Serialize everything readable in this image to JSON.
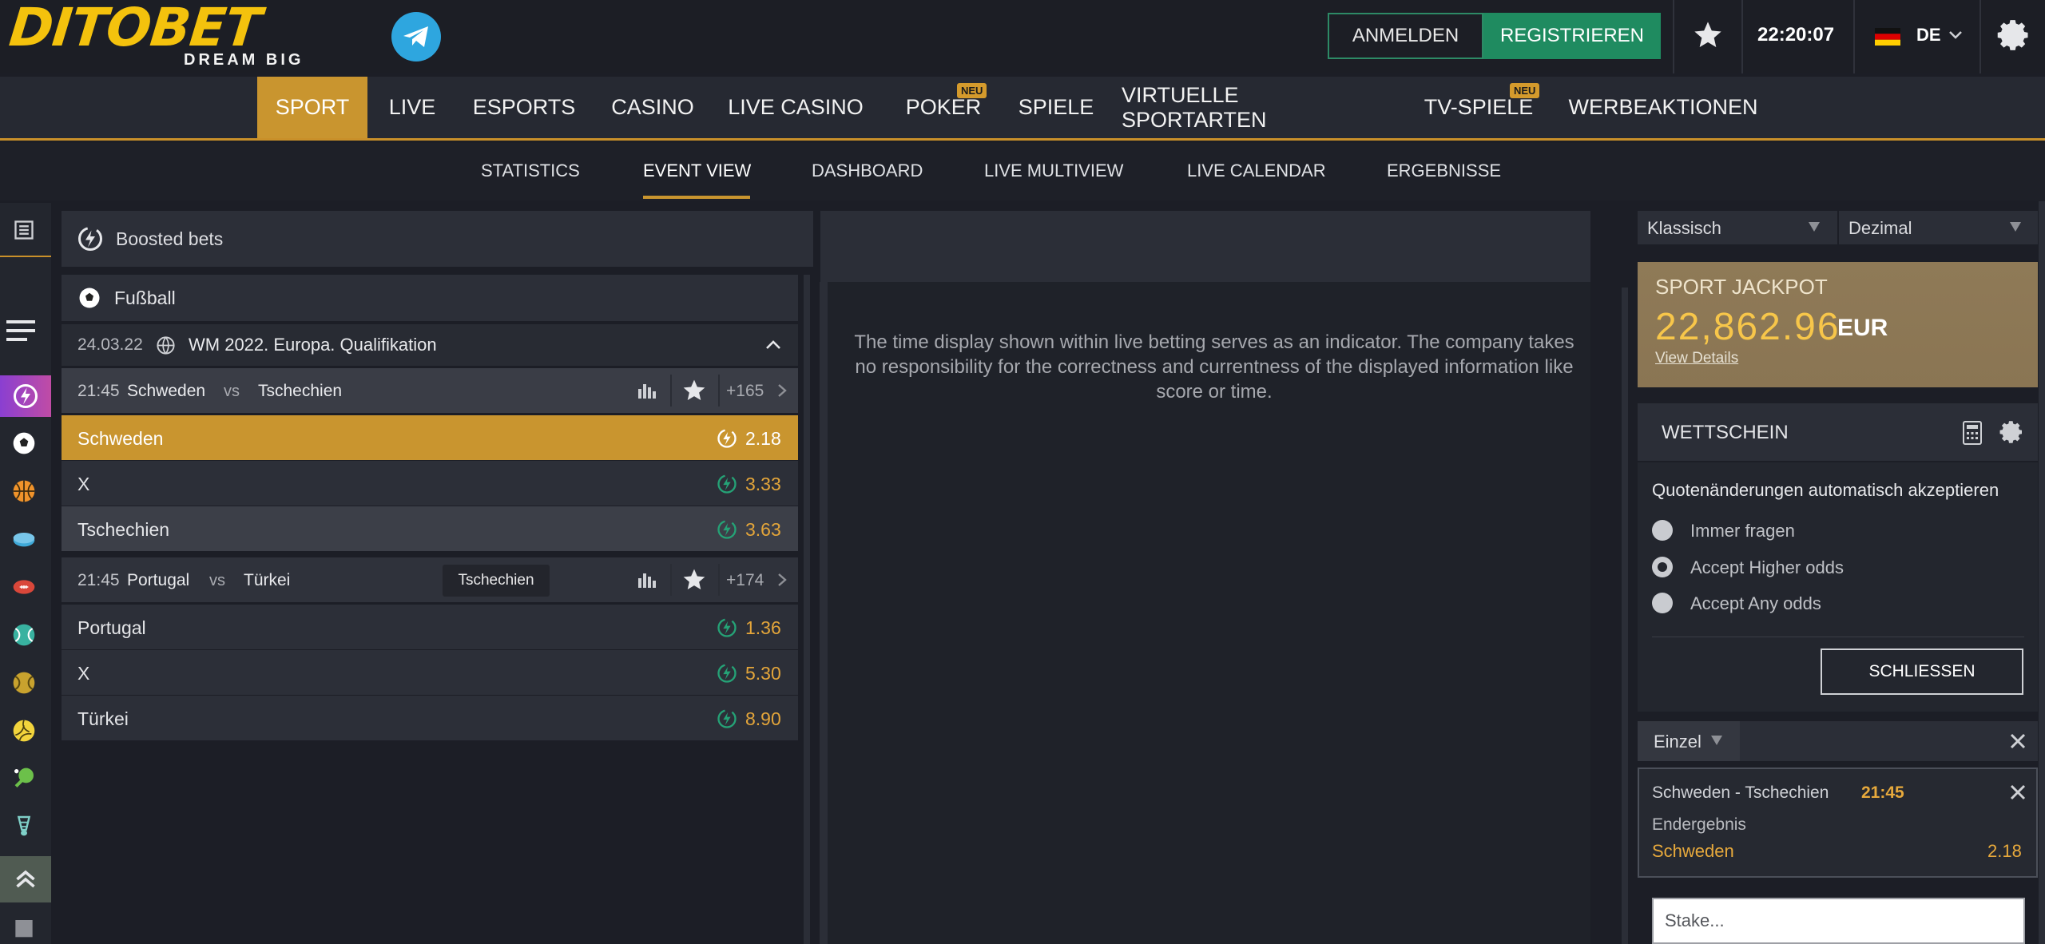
{
  "header": {
    "logo_text": "DITOBET",
    "logo_sub": "DREAM BIG",
    "login_label": "ANMELDEN",
    "register_label": "REGISTRIEREN",
    "clock": "22:20:07",
    "language": "DE"
  },
  "main_nav": [
    {
      "label": "SPORT",
      "active": true
    },
    {
      "label": "LIVE"
    },
    {
      "label": "ESPORTS"
    },
    {
      "label": "CASINO"
    },
    {
      "label": "LIVE CASINO"
    },
    {
      "label": "POKER",
      "badge": "NEU"
    },
    {
      "label": "SPIELE"
    },
    {
      "label": "VIRTUELLE SPORTARTEN"
    },
    {
      "label": "TV-SPIELE",
      "badge": "NEU"
    },
    {
      "label": "WERBEAKTIONEN"
    }
  ],
  "sub_nav": [
    {
      "label": "STATISTICS"
    },
    {
      "label": "EVENT VIEW",
      "active": true
    },
    {
      "label": "DASHBOARD"
    },
    {
      "label": "LIVE MULTIVIEW"
    },
    {
      "label": "LIVE CALENDAR"
    },
    {
      "label": "ERGEBNISSE"
    }
  ],
  "events": {
    "boosted_label": "Boosted bets",
    "sport_label": "Fußball",
    "league": {
      "date": "24.03.22",
      "name": "WM 2022. Europa. Qualifikation"
    },
    "matches": [
      {
        "time": "21:45",
        "home": "Schweden",
        "vs": "vs",
        "away": "Tschechien",
        "more": "+165",
        "odds": [
          {
            "name": "Schweden",
            "value": "2.18",
            "selected": true
          },
          {
            "name": "X",
            "value": "3.33"
          },
          {
            "name": "Tschechien",
            "value": "3.63",
            "hover": true
          }
        ]
      },
      {
        "time": "21:45",
        "home": "Portugal",
        "vs": "vs",
        "away": "Türkei",
        "more": "+174",
        "odds": [
          {
            "name": "Portugal",
            "value": "1.36"
          },
          {
            "name": "X",
            "value": "5.30"
          },
          {
            "name": "Türkei",
            "value": "8.90"
          }
        ]
      }
    ],
    "tooltip": "Tschechien"
  },
  "center": {
    "disclaimer": "The time display shown within live betting serves as an indicator. The company takes no responsibility for the correctness and currentness of the displayed information like score or time."
  },
  "right": {
    "view_mode": "Klassisch",
    "odds_format": "Dezimal",
    "jackpot": {
      "title": "SPORT JACKPOT",
      "amount": "22,862.96",
      "currency": "EUR",
      "link": "View Details"
    },
    "betslip": {
      "title": "WETTSCHEIN",
      "auto_accept": "Quotenänderungen automatisch akzeptieren",
      "options": [
        {
          "label": "Immer fragen",
          "checked": false
        },
        {
          "label": "Accept Higher odds",
          "checked": true
        },
        {
          "label": "Accept Any odds",
          "checked": false
        }
      ],
      "close_label": "SCHLIESSEN",
      "type": "Einzel",
      "item": {
        "match": "Schweden - Tschechien",
        "time": "21:45",
        "market": "Endergebnis",
        "pick": "Schweden",
        "odd": "2.18"
      },
      "stake_placeholder": "Stake..."
    }
  },
  "colors": {
    "accent": "#c9952f",
    "odds": "#e3a53a",
    "register": "#1f8b60",
    "background": "#1c1e26"
  }
}
